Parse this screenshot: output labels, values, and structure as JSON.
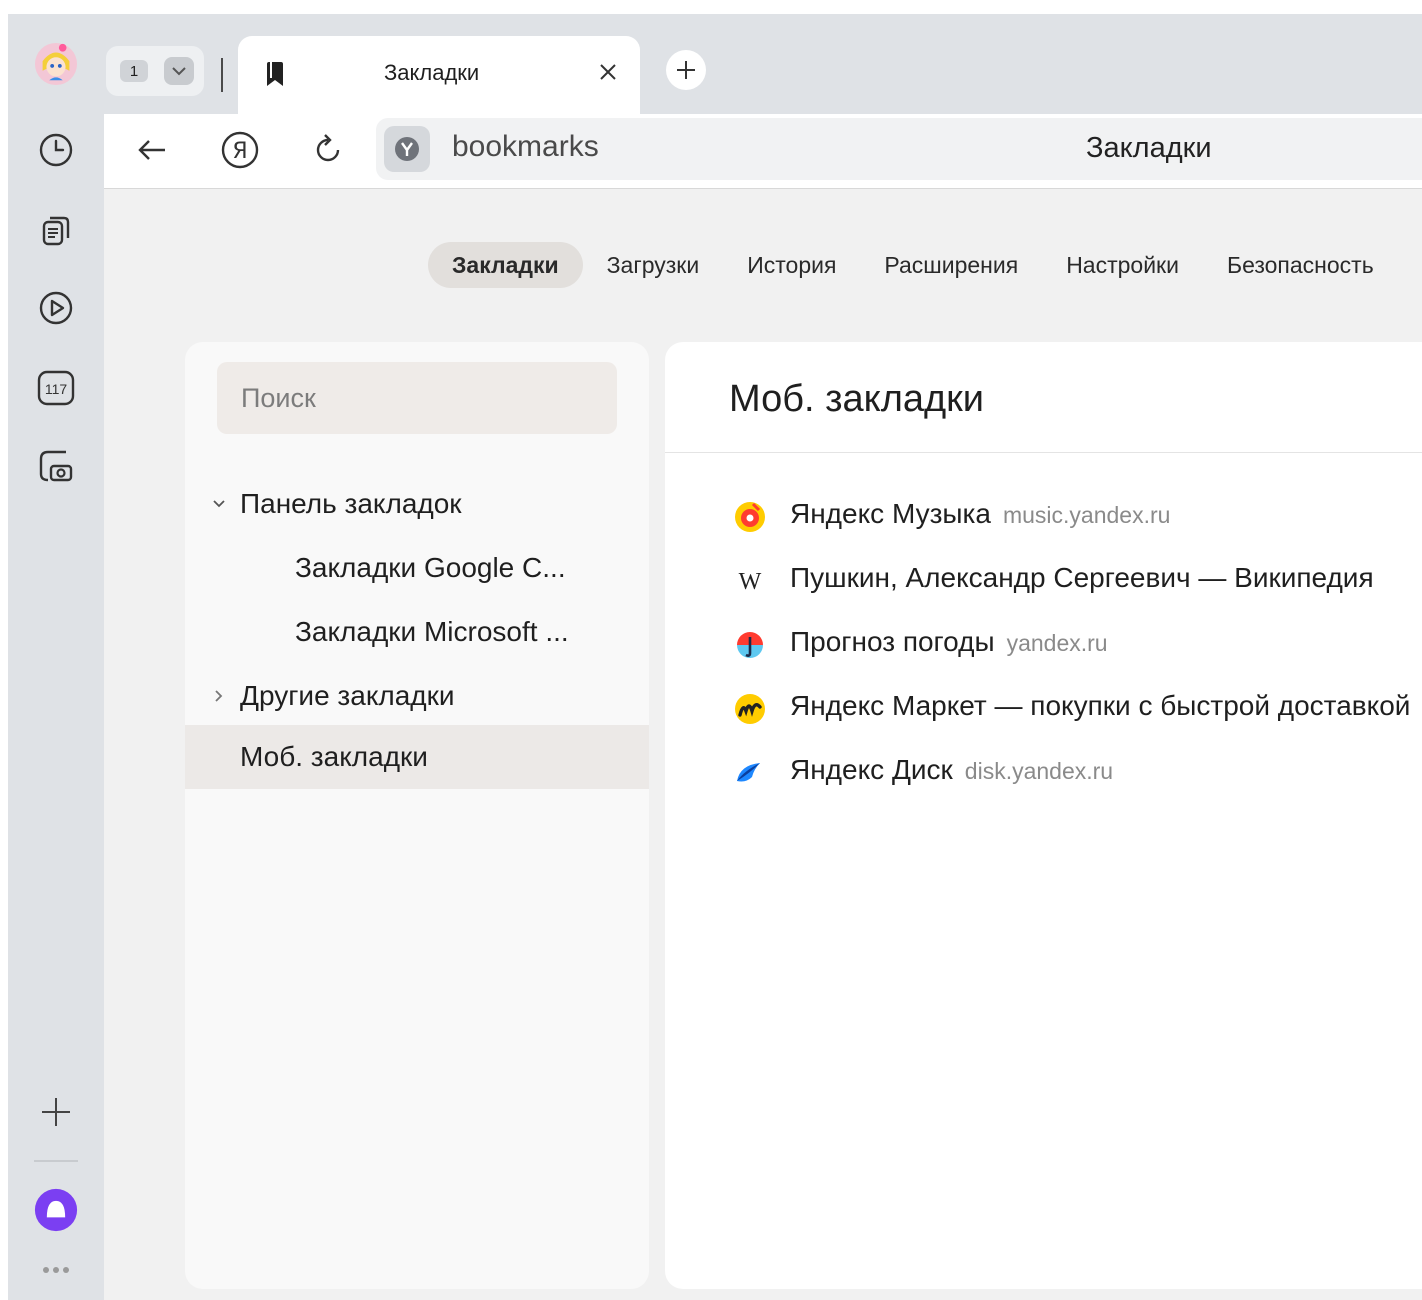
{
  "tabs": {
    "count": "1",
    "active": {
      "title": "Закладки"
    }
  },
  "sidebar": {
    "media_badge": "117"
  },
  "toolbar": {
    "url": "bookmarks",
    "page_title": "Закладки"
  },
  "nav": {
    "tabs": [
      {
        "label": "Закладки",
        "active": true
      },
      {
        "label": "Загрузки"
      },
      {
        "label": "История"
      },
      {
        "label": "Расширения"
      },
      {
        "label": "Настройки"
      },
      {
        "label": "Безопасность"
      }
    ]
  },
  "search": {
    "placeholder": "Поиск"
  },
  "tree": [
    {
      "label": "Панель закладок",
      "chevron": "expanded"
    },
    {
      "label": "Закладки Google C..."
    },
    {
      "label": "Закладки Microsoft ..."
    },
    {
      "label": "Другие закладки",
      "chevron": "collapsed"
    },
    {
      "label": "Моб. закладки",
      "selected": true
    }
  ],
  "folder": {
    "title": "Моб. закладки",
    "bookmarks": [
      {
        "title": "Яндекс Музыка",
        "host": "music.yandex.ru",
        "icon": "yandex-music-icon"
      },
      {
        "title": "Пушкин, Александр Сергеевич — Википедия",
        "host": "",
        "icon": "wikipedia-icon"
      },
      {
        "title": "Прогноз погоды",
        "host": "yandex.ru",
        "icon": "yandex-weather-icon"
      },
      {
        "title": "Яндекс Маркет — покупки с быстрой доставкой",
        "host": "",
        "icon": "yandex-market-icon"
      },
      {
        "title": "Яндекс Диск",
        "host": "disk.yandex.ru",
        "icon": "yandex-disk-icon"
      }
    ]
  },
  "colors": {
    "chrome_bg": "#dfe2e6",
    "page_bg": "#f1f1f1",
    "active_nav": "#e2dfdc",
    "alice": "#7b3ff2"
  }
}
